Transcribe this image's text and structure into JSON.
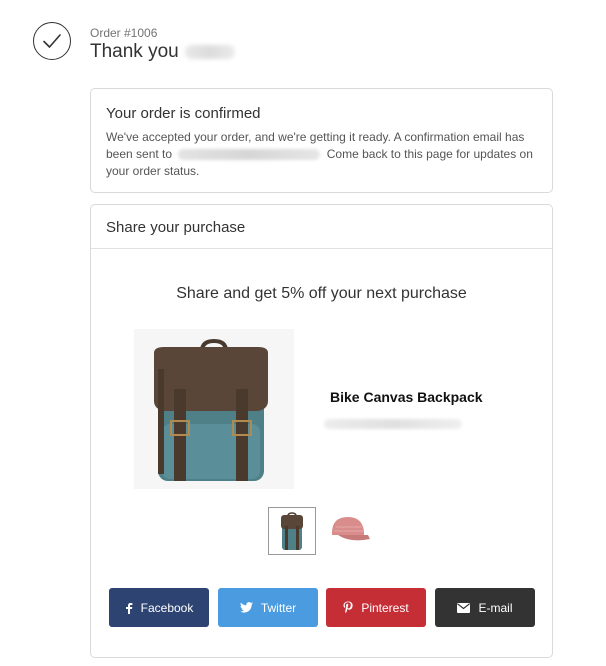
{
  "header": {
    "order_number": "Order #1006",
    "greeting": "Thank you"
  },
  "confirmation": {
    "title": "Your order is confirmed",
    "text_before_email": "We've accepted your order, and we're getting it ready. A confirmation email has been sent to",
    "text_after_email": "Come back to this page for updates on your order status."
  },
  "share": {
    "header_title": "Share your purchase",
    "promo": "Share and get 5% off your next purchase",
    "product_name": "Bike Canvas Backpack",
    "buttons": {
      "facebook": "Facebook",
      "twitter": "Twitter",
      "pinterest": "Pinterest",
      "email": "E-mail"
    }
  },
  "colors": {
    "facebook": "#2d4372",
    "twitter": "#4b9be0",
    "pinterest": "#c62e36",
    "email": "#333333"
  },
  "icons": [
    "check-icon",
    "facebook-icon",
    "twitter-icon",
    "pinterest-icon",
    "mail-icon"
  ]
}
